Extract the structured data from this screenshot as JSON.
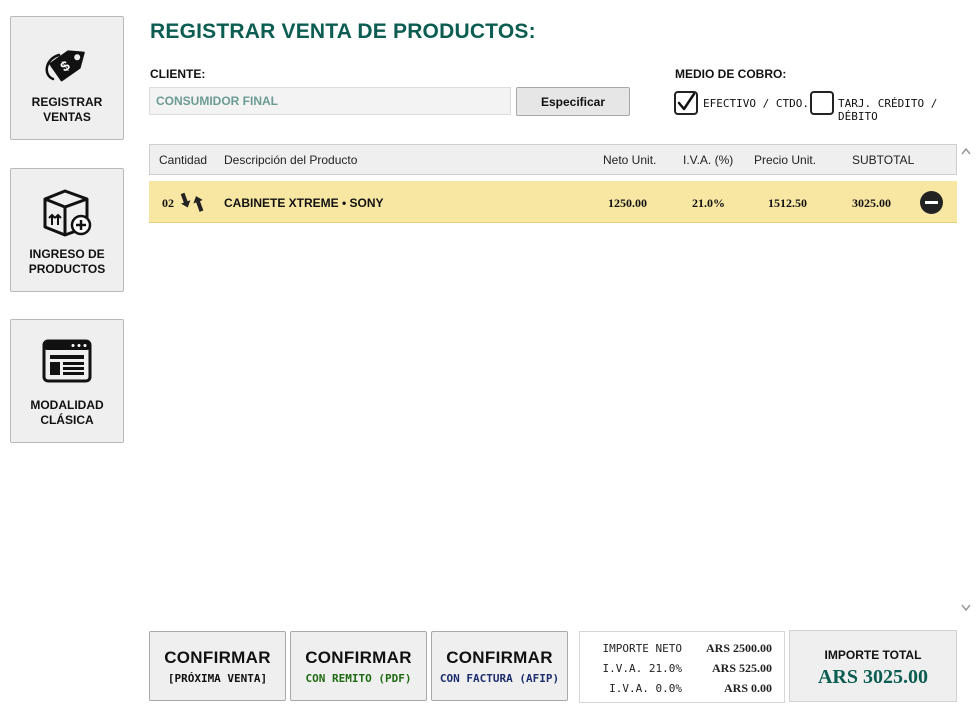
{
  "sidebar": {
    "items": [
      {
        "label": "REGISTRAR\nVENTAS",
        "icon": "price-tag-icon"
      },
      {
        "label": "INGRESO DE\nPRODUCTOS",
        "icon": "box-add-icon"
      },
      {
        "label": "MODALIDAD\nCLÁSICA",
        "icon": "window-list-icon"
      }
    ]
  },
  "header": {
    "title": "REGISTRAR VENTA DE PRODUCTOS:",
    "client_label": "CLIENTE:",
    "client_value": "",
    "client_placeholder": "CONSUMIDOR FINAL",
    "specify_button": "Especificar",
    "payment_label": "MEDIO DE COBRO:",
    "payment_options": [
      {
        "label": "EFECTIVO / CTDO.",
        "checked": true
      },
      {
        "label": "TARJ. CRÉDITO / DÉBITO",
        "checked": false
      }
    ]
  },
  "table": {
    "columns": [
      "Cantidad",
      "Descripción del Producto",
      "Neto Unit.",
      "I.V.A. (%)",
      "Precio Unit.",
      "SUBTOTAL"
    ],
    "rows": [
      {
        "cantidad": "02",
        "descripcion": "CABINETE XTREME • SONY",
        "neto": "1250.00",
        "iva": "21.0%",
        "precio": "1512.50",
        "subtotal": "3025.00"
      }
    ]
  },
  "footer": {
    "buttons": [
      {
        "main": "CONFIRMAR",
        "sub": "[PRÓXIMA VENTA]",
        "sub_color": "#111111"
      },
      {
        "main": "CONFIRMAR",
        "sub": "CON REMITO (PDF)",
        "sub_color": "#1f6b12"
      },
      {
        "main": "CONFIRMAR",
        "sub": "CON FACTURA (AFIP)",
        "sub_color": "#1c2e6e"
      }
    ],
    "totals": [
      {
        "label": "IMPORTE NETO",
        "value": "ARS 2500.00"
      },
      {
        "label": "I.V.A. 21.0%",
        "value": "ARS 525.00"
      },
      {
        "label": "I.V.A. 0.0%",
        "value": "ARS 0.00"
      }
    ],
    "total_label": "IMPORTE TOTAL",
    "total_value": "ARS 3025.00"
  },
  "colors": {
    "accent": "#0b5d52",
    "row_highlight": "#f8e7a3",
    "panel": "#efefef"
  }
}
